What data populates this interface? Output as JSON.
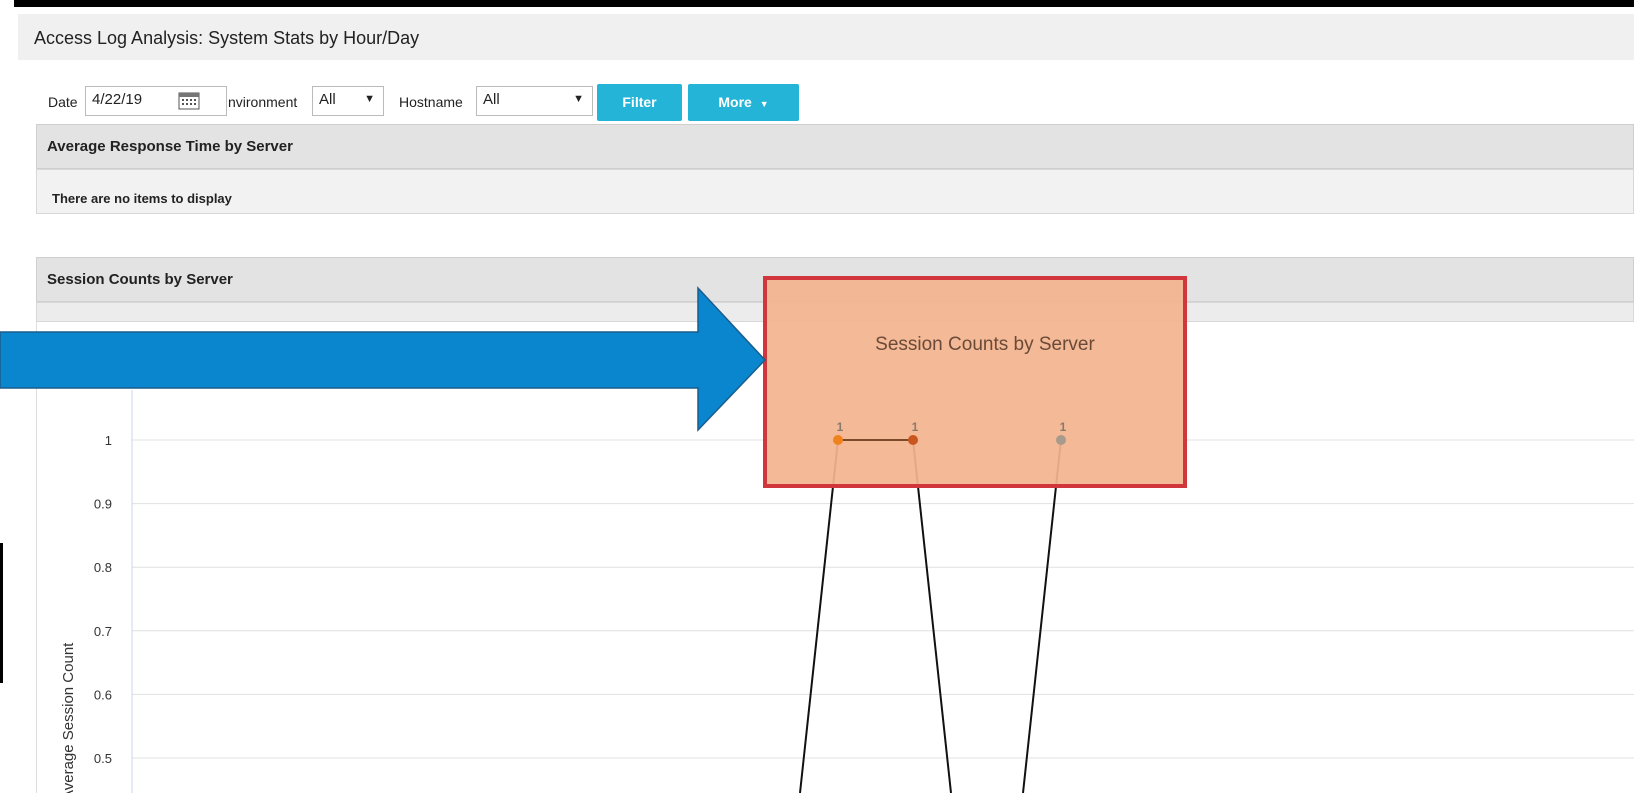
{
  "title": "Access Log Analysis: System Stats by Hour/Day",
  "filters": {
    "date_label": "Date",
    "date_value": "4/22/19",
    "environment_label": "nvironment",
    "environment_value": "All",
    "hostname_label": "Hostname",
    "hostname_value": "All",
    "filter_button": "Filter",
    "more_button": "More"
  },
  "panels": {
    "avg_response": {
      "title": "Average Response Time by Server",
      "empty_text": "There are no items to display"
    },
    "session_counts": {
      "title": "Session Counts by Server"
    }
  },
  "colors": {
    "accent": "#23b4d8",
    "arrow": "#0a86cf",
    "highlight": "#f3b48e",
    "highlight_border": "#d0363b"
  },
  "chart_data": {
    "type": "line",
    "title": "Session Counts by Server",
    "ylabel": "Average Session Count",
    "ylim": [
      0.5,
      1
    ],
    "yticks": [
      "1",
      "0.9",
      "0.8",
      "0.7",
      "0.6",
      "0.5"
    ],
    "grid": true,
    "series": [
      {
        "points": [
          1,
          1
        ],
        "labels": [
          "1",
          "1"
        ],
        "colors": [
          "#f0821e",
          "#c9561f"
        ]
      },
      {
        "points": [
          1
        ],
        "labels": [
          "1"
        ],
        "colors": [
          "#a89a8d"
        ]
      }
    ]
  }
}
